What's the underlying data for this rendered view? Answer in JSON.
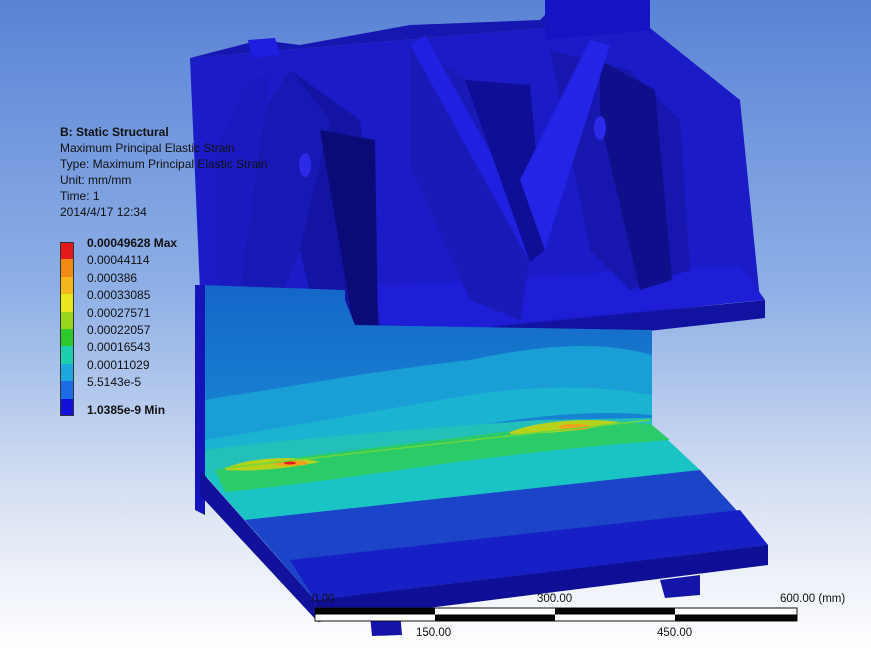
{
  "info": {
    "title": "B: Static Structural",
    "result_name": "Maximum Principal Elastic Strain",
    "type_line": "Type: Maximum Principal Elastic Strain",
    "unit_line": "Unit: mm/mm",
    "time_line": "Time: 1",
    "date_line": "2014/4/17 12:34"
  },
  "legend": [
    {
      "label": "0.00049628 Max",
      "color": "#e31a1c",
      "bold": true
    },
    {
      "label": "0.00044114",
      "color": "#f08a12",
      "bold": false
    },
    {
      "label": "0.000386",
      "color": "#f4b81c",
      "bold": false
    },
    {
      "label": "0.00033085",
      "color": "#e8e81c",
      "bold": false
    },
    {
      "label": "0.00027571",
      "color": "#9ad61c",
      "bold": false
    },
    {
      "label": "0.00022057",
      "color": "#2cc82c",
      "bold": false
    },
    {
      "label": "0.00016543",
      "color": "#1ccfae",
      "bold": false
    },
    {
      "label": "0.00011029",
      "color": "#1ca9e0",
      "bold": false
    },
    {
      "label": "5.5143e-5",
      "color": "#1c6ce8",
      "bold": false
    },
    {
      "label": "1.0385e-9 Min",
      "color": "#1010d8",
      "bold": true
    }
  ],
  "scale_bar": {
    "labels_top": [
      "0.00",
      "300.00",
      "600.00 (mm)"
    ],
    "labels_bottom": [
      "150.00",
      "450.00"
    ]
  },
  "colors": {
    "body_blue": "#1a1ad0",
    "body_dark": "#0d0d8a",
    "shade_blue": "#1430b8"
  }
}
